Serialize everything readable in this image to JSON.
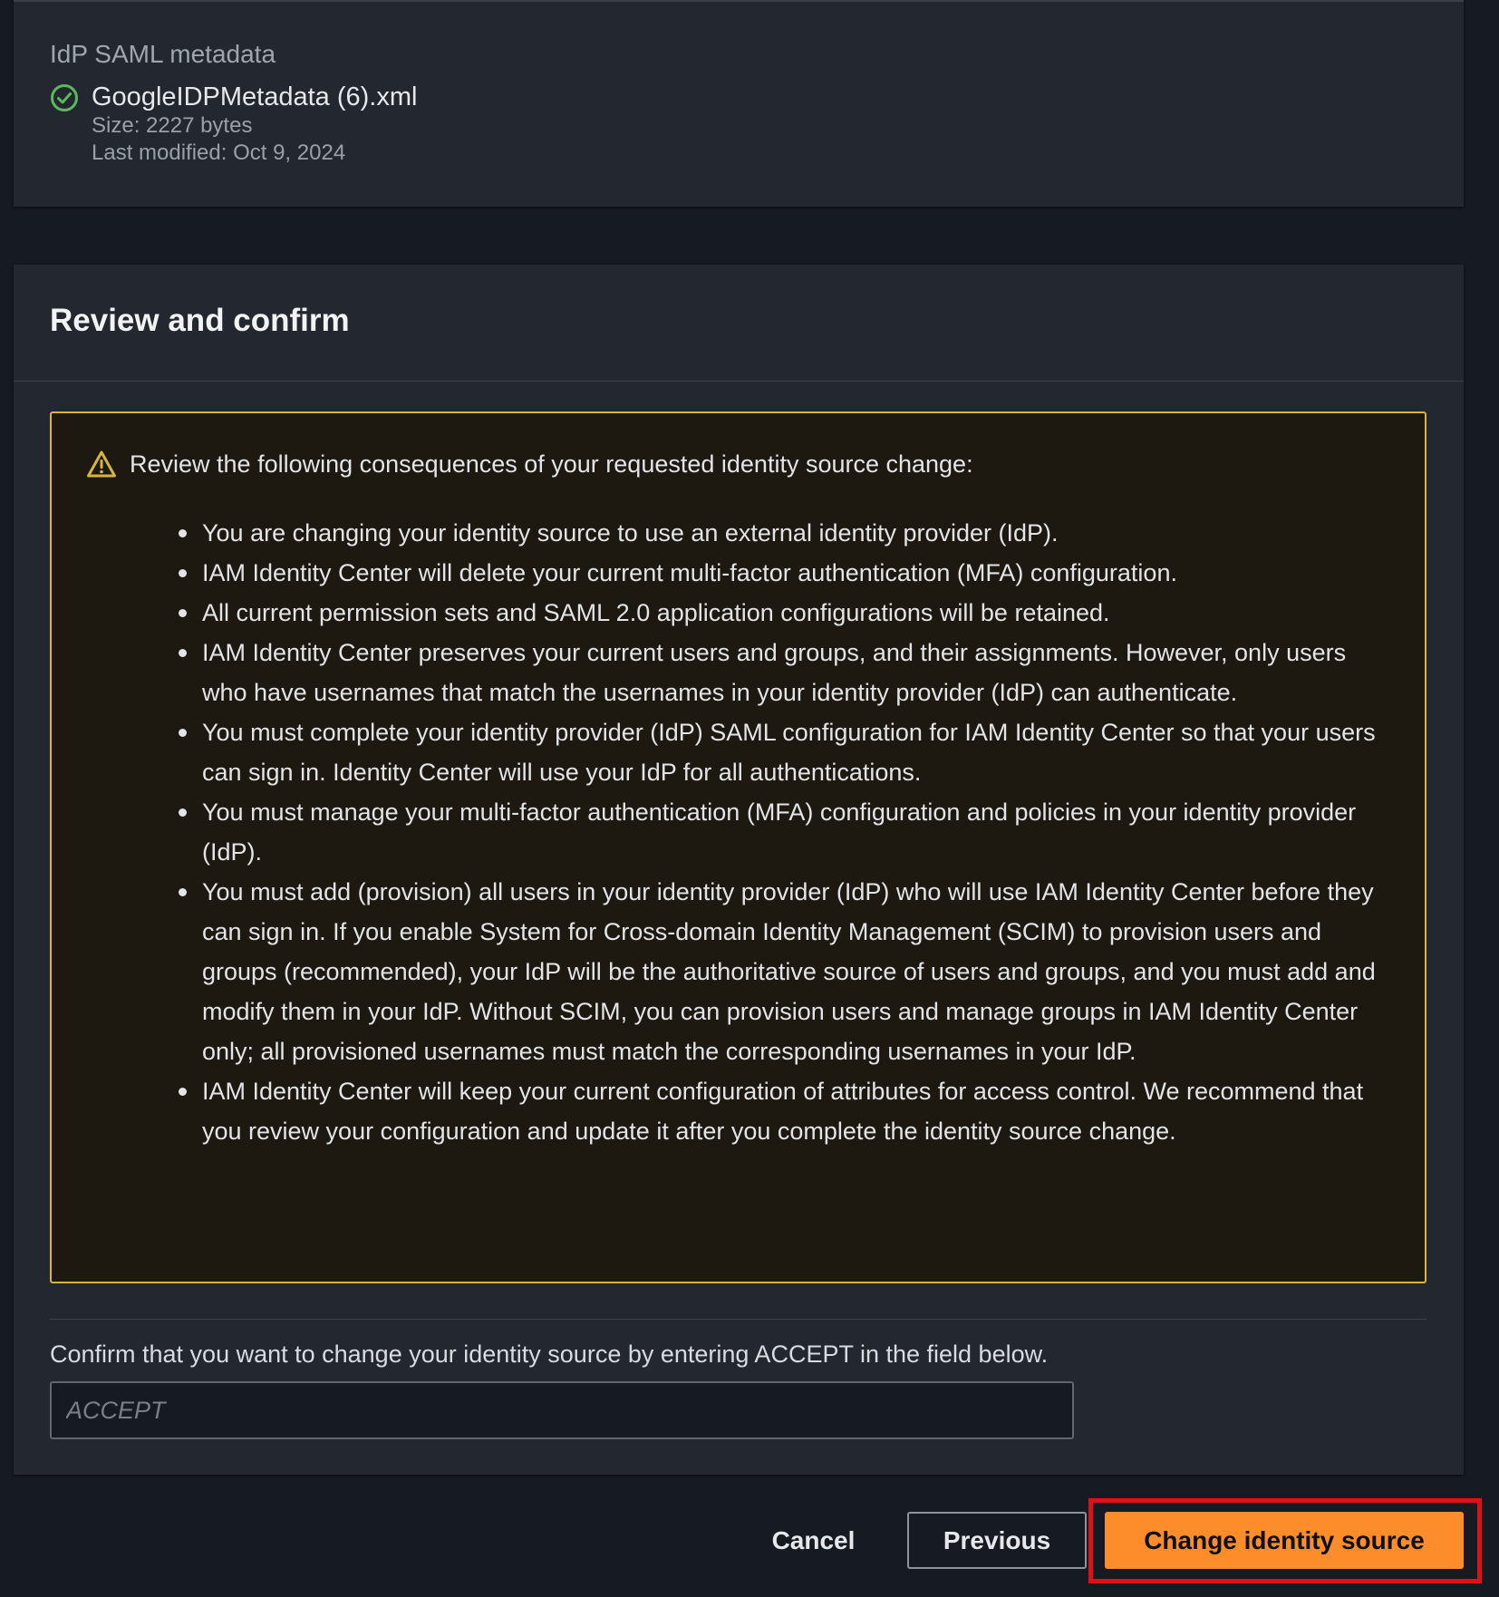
{
  "metadata": {
    "label": "IdP SAML metadata",
    "file_name": "GoogleIDPMetadata (6).xml",
    "size": "Size: 2227 bytes",
    "last_modified": "Last modified: Oct 9, 2024",
    "status_icon": "check-circle-icon"
  },
  "review": {
    "title": "Review and confirm",
    "warning_icon": "warning-triangle-icon",
    "warning_text": "Review the following consequences of your requested identity source change:",
    "bullets": [
      "You are changing your identity source to use an external identity provider (IdP).",
      "IAM Identity Center will delete your current multi-factor authentication (MFA) configuration.",
      "All current permission sets and SAML 2.0 application configurations will be retained.",
      "IAM Identity Center preserves your current users and groups, and their assignments. However, only users who have usernames that match the usernames in your identity provider (IdP) can authenticate.",
      "You must complete your identity provider (IdP) SAML configuration for IAM Identity Center so that your users can sign in. Identity Center will use your IdP for all authentications.",
      "You must manage your multi-factor authentication (MFA) configuration and policies in your identity provider (IdP).",
      "You must add (provision) all users in your identity provider (IdP) who will use IAM Identity Center before they can sign in. If you enable System for Cross-domain Identity Management (SCIM) to provision users and groups (recommended), your IdP will be the authoritative source of users and groups, and you must add and modify them in your IdP. Without SCIM, you can provision users and manage groups in IAM Identity Center only; all provisioned usernames must match the corresponding usernames in your IdP.",
      "IAM Identity Center will keep your current configuration of attributes for access control. We recommend that you review your configuration and update it after you complete the identity source change."
    ],
    "confirm_text": "Confirm that you want to change your identity source by entering ACCEPT in the field below.",
    "input_placeholder": "ACCEPT",
    "input_value": ""
  },
  "actions": {
    "cancel_label": "Cancel",
    "previous_label": "Previous",
    "primary_label": "Change identity source"
  },
  "colors": {
    "primary_button": "#fd8d2a",
    "warning_border": "#d6b53a",
    "success_icon": "#5cb85c",
    "highlight": "#e0101b"
  }
}
